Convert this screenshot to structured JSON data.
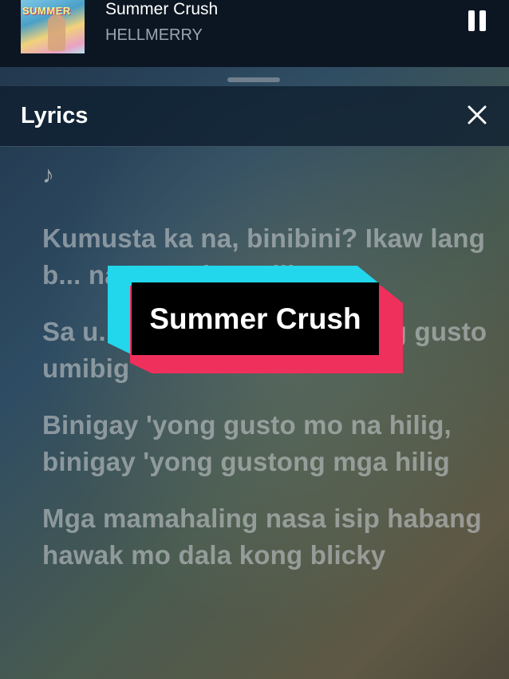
{
  "player": {
    "album_art_text": "SUMMER",
    "title": "Summer Crush",
    "artist": "HELLMERRY",
    "pause_icon": "pause-icon"
  },
  "lyrics_sheet": {
    "title": "Lyrics",
    "close_icon": "close-icon",
    "note_symbol": "♪",
    "lines": [
      "Kumusta ka na, binibini? Ikaw lang b... nasa ta...ban...iling",
      "Sa u... ...g, kung ikaw parang gusto umibig",
      "Binigay 'yong gusto mo na hilig, binigay 'yong gustong mga hilig",
      "Mga mamahaling nasa isip habang hawak mo dala kong blicky"
    ]
  },
  "overlay": {
    "caption": "Summer Crush",
    "colors": {
      "cyan": "#22d6ec",
      "red": "#f0305c",
      "black": "#000000"
    }
  }
}
